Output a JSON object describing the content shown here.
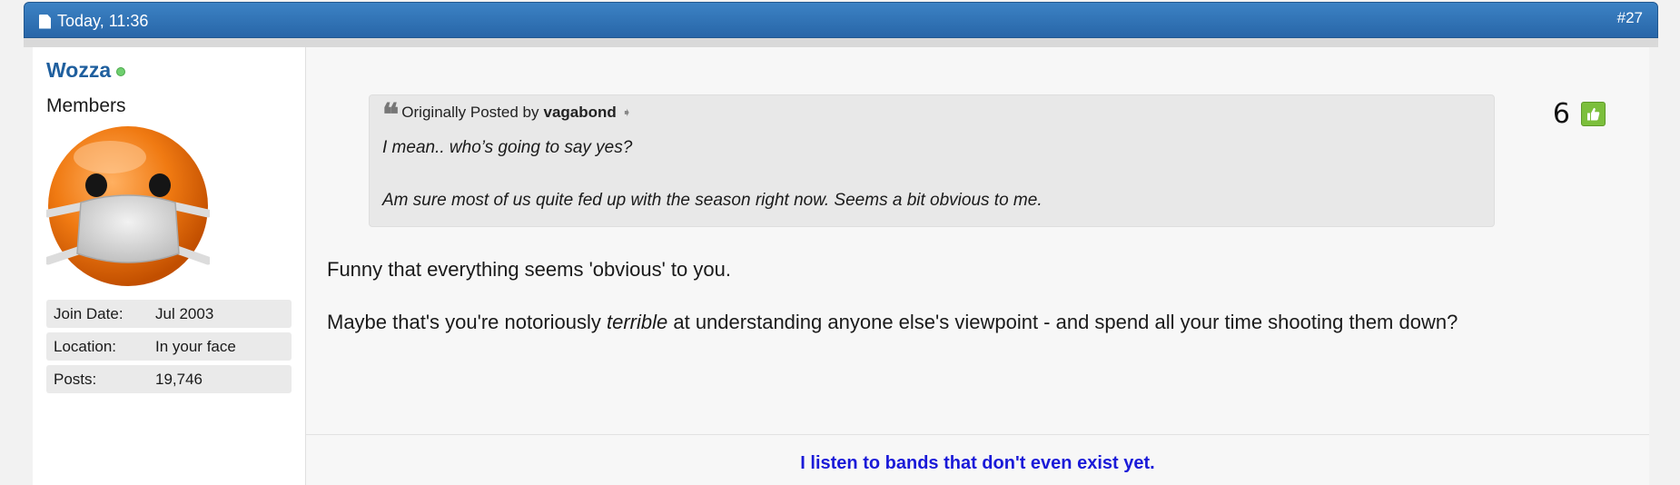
{
  "header": {
    "date": "Today, 11:36",
    "post_number": "#27"
  },
  "user": {
    "name": "Wozza",
    "status": "online",
    "title": "Members",
    "stats": [
      {
        "label": "Join Date:",
        "value": "Jul 2003"
      },
      {
        "label": "Location:",
        "value": "In your face"
      },
      {
        "label": "Posts:",
        "value": "19,746"
      }
    ]
  },
  "quote": {
    "prefix": "Originally Posted by",
    "author": "vagabond",
    "lines": [
      "I mean.. who’s going to say yes?",
      "Am sure most of us quite fed up with the season right now. Seems a bit obvious to me."
    ]
  },
  "reputation": {
    "count": "6"
  },
  "message": {
    "para1": "Funny that everything seems 'obvious' to you.",
    "para2_before": "Maybe that's you're notoriously ",
    "para2_emph": "terrible",
    "para2_after": " at understanding anyone else's viewpoint - and spend all your time shooting them down?"
  },
  "signature": "I listen to bands that don't even exist yet.",
  "colors": {
    "header_blue": "#2f72b6",
    "username": "#1f5f9e",
    "online": "#6fcf6f",
    "like_green": "#7cbf3c",
    "signature": "#1a1ad8"
  }
}
